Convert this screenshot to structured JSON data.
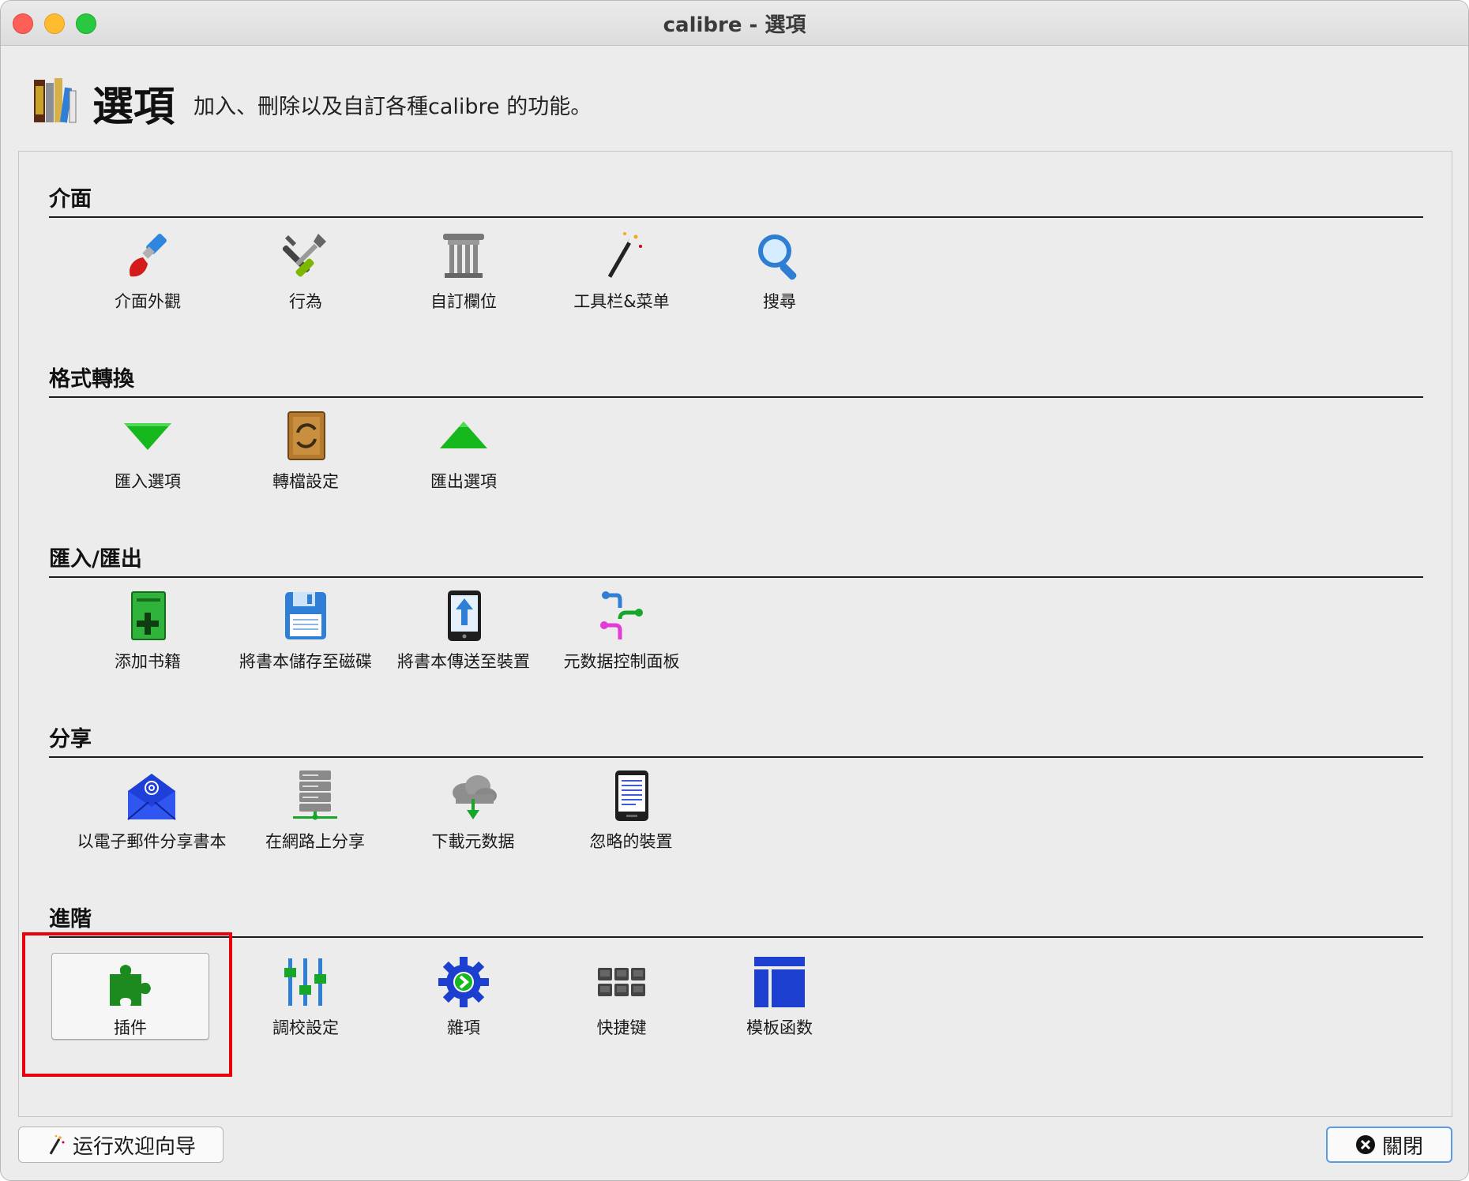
{
  "window": {
    "title": "calibre - 選項"
  },
  "header": {
    "title": "選項",
    "description": "加入、刪除以及自訂各種calibre 的功能。"
  },
  "sections": [
    {
      "title": "介面",
      "items": [
        {
          "label": "介面外觀",
          "icon": "paintbrush-icon"
        },
        {
          "label": "行為",
          "icon": "tools-icon"
        },
        {
          "label": "自訂欄位",
          "icon": "column-icon"
        },
        {
          "label": "工具栏&菜单",
          "icon": "magic-wand-icon"
        },
        {
          "label": "搜尋",
          "icon": "search-icon"
        }
      ]
    },
    {
      "title": "格式轉換",
      "items": [
        {
          "label": "匯入選項",
          "icon": "arrow-down-icon"
        },
        {
          "label": "轉檔設定",
          "icon": "convert-book-icon"
        },
        {
          "label": "匯出選項",
          "icon": "arrow-up-icon"
        }
      ]
    },
    {
      "title": "匯入/匯出",
      "items": [
        {
          "label": "添加书籍",
          "icon": "add-book-icon"
        },
        {
          "label": "將書本儲存至磁碟",
          "icon": "floppy-disk-icon"
        },
        {
          "label": "將書本傳送至裝置",
          "icon": "send-device-icon"
        },
        {
          "label": "元数据控制面板",
          "icon": "metadata-plugboard-icon"
        }
      ]
    },
    {
      "title": "分享",
      "items": [
        {
          "label": "以電子郵件分享書本",
          "icon": "email-icon"
        },
        {
          "label": "在網路上分享",
          "icon": "server-icon"
        },
        {
          "label": "下載元数据",
          "icon": "cloud-download-icon"
        },
        {
          "label": "忽略的裝置",
          "icon": "ebook-reader-icon"
        }
      ]
    },
    {
      "title": "進階",
      "items": [
        {
          "label": "插件",
          "icon": "puzzle-icon"
        },
        {
          "label": "調校設定",
          "icon": "sliders-icon"
        },
        {
          "label": "雜項",
          "icon": "gear-icon"
        },
        {
          "label": "快捷键",
          "icon": "keyboard-icon"
        },
        {
          "label": "模板函数",
          "icon": "template-icon"
        }
      ]
    }
  ],
  "footer": {
    "wizard_label": "运行欢迎向导",
    "close_label": "關閉"
  },
  "colors": {
    "highlight": "#e8000b",
    "close_focus": "#5b9ae6"
  }
}
